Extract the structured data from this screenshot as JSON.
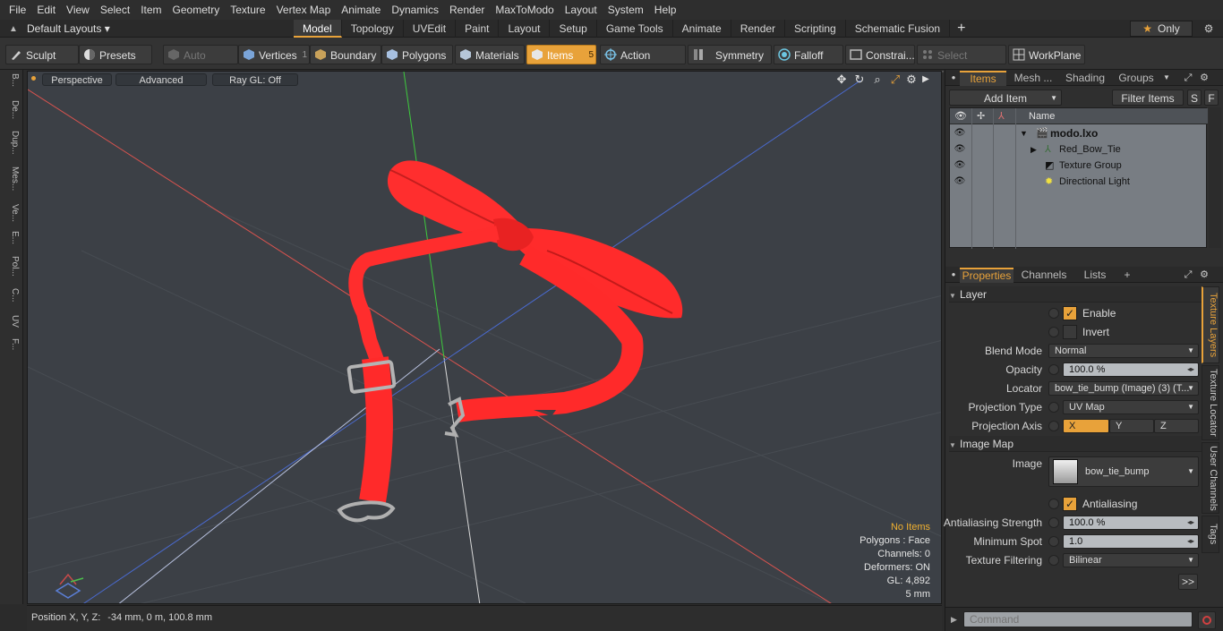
{
  "menu": [
    "File",
    "Edit",
    "View",
    "Select",
    "Item",
    "Geometry",
    "Texture",
    "Vertex Map",
    "Animate",
    "Dynamics",
    "Render",
    "MaxToModo",
    "Layout",
    "System",
    "Help"
  ],
  "layouts": {
    "label": "Default Layouts"
  },
  "tabs": [
    "Model",
    "Topology",
    "UVEdit",
    "Paint",
    "Layout",
    "Setup",
    "Game Tools",
    "Animate",
    "Render",
    "Scripting",
    "Schematic Fusion"
  ],
  "tabs_plus": "+",
  "only_label": "Only",
  "toolbar": {
    "sculpt": "Sculpt",
    "presets": "Presets",
    "auto_select": "Auto Select",
    "vertices": "Vertices",
    "vertices_count": "1",
    "boundary": "Boundary",
    "polygons": "Polygons",
    "materials": "Materials",
    "items": "Items",
    "items_count": "5",
    "action_center": "Action Center",
    "symmetry": "Symmetry",
    "falloff": "Falloff",
    "constraints": "Constrai...",
    "select_through": "Select Through",
    "workplane": "WorkPlane"
  },
  "leftstrip": [
    "B...",
    "De...",
    "Dup...",
    "Mes...",
    "Ve...",
    "E...",
    "Pol...",
    "C...",
    "UV",
    "F..."
  ],
  "viewport": {
    "perspective": "Perspective",
    "advanced": "Advanced",
    "raygl": "Ray GL: Off",
    "info": {
      "no_items": "No Items",
      "polygons": "Polygons : Face",
      "channels": "Channels: 0",
      "deformers": "Deformers: ON",
      "gl": "GL: 4,892",
      "scale": "5 mm"
    }
  },
  "status": {
    "label": "Position X, Y, Z:",
    "value": "-34 mm, 0 m, 100.8 mm"
  },
  "items_panel": {
    "tabs": [
      "Items",
      "Mesh ...",
      "Shading",
      "Groups"
    ],
    "add_item": "Add Item",
    "filter_items": "Filter Items",
    "s": "S",
    "f": "F",
    "col_name": "Name",
    "rows": [
      {
        "label": "modo.lxo"
      },
      {
        "label": "Red_Bow_Tie"
      },
      {
        "label": "Texture Group"
      },
      {
        "label": "Directional Light"
      }
    ]
  },
  "props_panel": {
    "tabs": [
      "Properties",
      "Channels",
      "Lists"
    ],
    "plus": "+",
    "layer_section": "Layer",
    "enable": "Enable",
    "invert": "Invert",
    "blend_mode_label": "Blend Mode",
    "blend_mode": "Normal",
    "opacity_label": "Opacity",
    "opacity": "100.0 %",
    "locator_label": "Locator",
    "locator": "bow_tie_bump (Image) (3) (T...",
    "projection_type_label": "Projection Type",
    "projection_type": "UV Map",
    "projection_axis_label": "Projection Axis",
    "axis_x": "X",
    "axis_y": "Y",
    "axis_z": "Z",
    "image_map_section": "Image Map",
    "image_label": "Image",
    "image": "bow_tie_bump",
    "antialiasing": "Antialiasing",
    "aa_strength_label": "Antialiasing Strength",
    "aa_strength": "100.0 %",
    "min_spot_label": "Minimum Spot",
    "min_spot": "1.0",
    "tex_filter_label": "Texture Filtering",
    "tex_filter": "Bilinear",
    "more": ">>",
    "side_tabs": [
      "Texture Layers",
      "Texture Locator",
      "User Channels",
      "Tags"
    ]
  },
  "command": {
    "placeholder": "Command"
  },
  "colors": {
    "accent": "#e8a23a",
    "viewport_bg": "#3c4046",
    "object": "#ff3030"
  }
}
